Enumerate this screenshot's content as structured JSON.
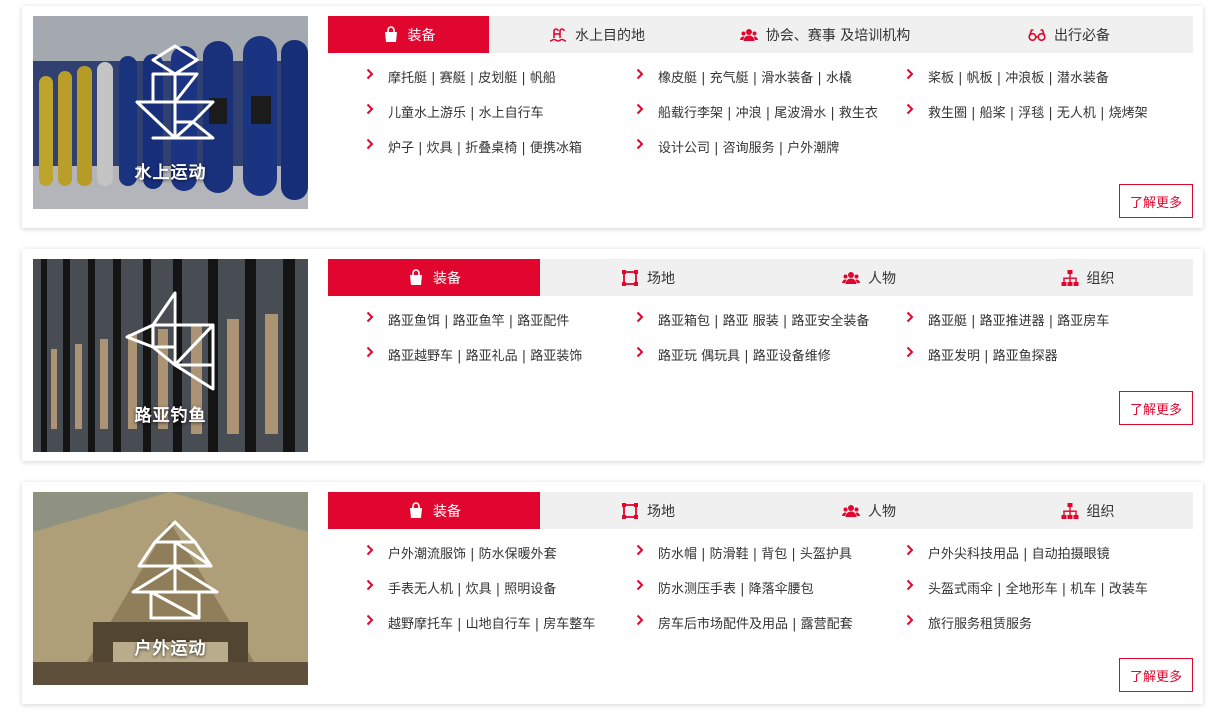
{
  "accent": "#e0062e",
  "sections": [
    {
      "caption": "水上运动",
      "tabs": [
        {
          "label": "装备",
          "icon": "shopping-bag-icon"
        },
        {
          "label": "水上目的地",
          "icon": "pool-ladder-icon"
        },
        {
          "label": "协会、赛事 及培训机构",
          "icon": "users-icon"
        },
        {
          "label": "出行必备",
          "icon": "glasses-icon"
        }
      ],
      "rows": [
        [
          "摩托艇 | 赛艇 | 皮划艇 | 帆船",
          "橡皮艇 | 充气艇 | 滑水装备 | 水橇",
          "桨板 | 帆板 | 冲浪板 | 潜水装备"
        ],
        [
          "儿童水上游乐 | 水上自行车",
          "船载行李架 | 冲浪 | 尾波滑水 | 救生衣",
          "救生圈 | 船桨 | 浮毯 | 无人机 | 烧烤架"
        ],
        [
          "炉子 | 炊具 | 折叠桌椅 | 便携冰箱",
          "设计公司 | 咨询服务 | 户外潮牌"
        ]
      ],
      "more_label": "了解更多"
    },
    {
      "caption": "路亚钓鱼",
      "tabs": [
        {
          "label": "装备",
          "icon": "shopping-bag-icon"
        },
        {
          "label": "场地",
          "icon": "venue-frame-icon"
        },
        {
          "label": "人物",
          "icon": "users-icon"
        },
        {
          "label": "组织",
          "icon": "org-chart-icon"
        }
      ],
      "rows": [
        [
          "路亚鱼饵 | 路亚鱼竿 | 路亚配件",
          "路亚箱包 | 路亚 服装 | 路亚安全装备",
          "路亚艇 | 路亚推进器 | 路亚房车"
        ],
        [
          "路亚越野车 | 路亚礼品 | 路亚装饰",
          "路亚玩 偶玩具 | 路亚设备维修",
          "路亚发明 | 路亚鱼探器"
        ]
      ],
      "more_label": "了解更多"
    },
    {
      "caption": "户外运动",
      "tabs": [
        {
          "label": "装备",
          "icon": "shopping-bag-icon"
        },
        {
          "label": "场地",
          "icon": "venue-frame-icon"
        },
        {
          "label": "人物",
          "icon": "users-icon"
        },
        {
          "label": "组织",
          "icon": "org-chart-icon"
        }
      ],
      "rows": [
        [
          "户外潮流服饰 | 防水保暖外套",
          "防水帽 | 防滑鞋 | 背包 | 头盔护具",
          "户外尖科技用品 | 自动拍摄眼镜"
        ],
        [
          "手表无人机 | 炊具 | 照明设备",
          "防水测压手表 | 降落伞腰包",
          "头盔式雨伞 | 全地形车 | 机车 | 改装车"
        ],
        [
          "越野摩托车 | 山地自行车 | 房车整车",
          "房车后市场配件及用品 | 露营配套",
          "旅行服务租赁服务"
        ]
      ],
      "more_label": "了解更多"
    }
  ]
}
